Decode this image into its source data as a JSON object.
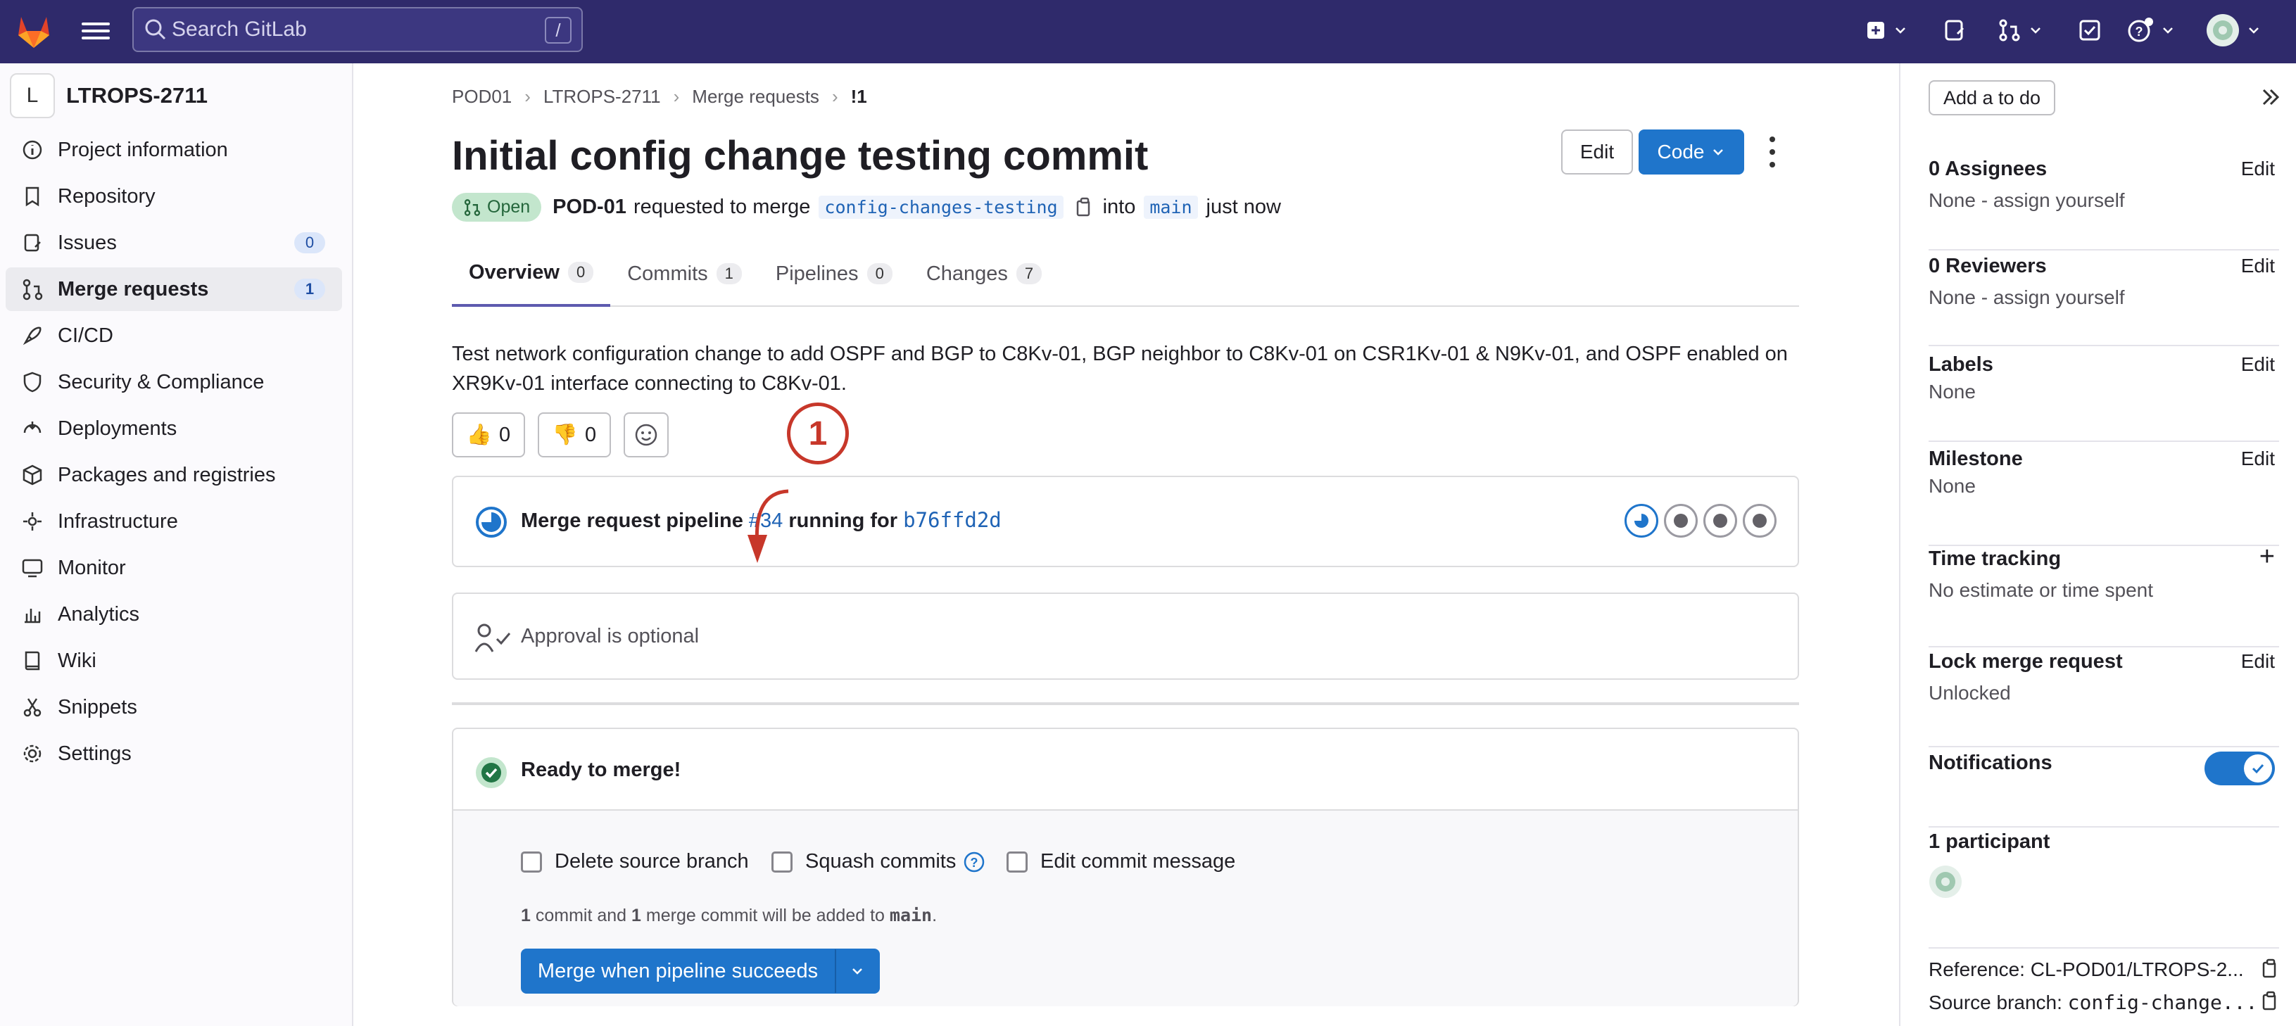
{
  "topbar": {
    "search_placeholder": "Search GitLab",
    "search_shortcut": "/",
    "icons": [
      "gitlab-logo-icon",
      "hamburger-icon",
      "search-icon",
      "new-item-icon",
      "issues-icon",
      "merge-requests-icon",
      "todos-icon",
      "help-icon",
      "avatar-icon"
    ]
  },
  "sidebar": {
    "project_initial": "L",
    "project_name": "LTROPS-2711",
    "items": [
      {
        "label": "Project information",
        "icon": "info-icon"
      },
      {
        "label": "Repository",
        "icon": "repository-icon"
      },
      {
        "label": "Issues",
        "icon": "issues-icon",
        "badge": "0"
      },
      {
        "label": "Merge requests",
        "icon": "merge-request-icon",
        "badge": "1",
        "active": true
      },
      {
        "label": "CI/CD",
        "icon": "rocket-icon"
      },
      {
        "label": "Security & Compliance",
        "icon": "shield-icon"
      },
      {
        "label": "Deployments",
        "icon": "deployments-icon"
      },
      {
        "label": "Packages and registries",
        "icon": "package-icon"
      },
      {
        "label": "Infrastructure",
        "icon": "cloud-icon"
      },
      {
        "label": "Monitor",
        "icon": "monitor-icon"
      },
      {
        "label": "Analytics",
        "icon": "chart-icon"
      },
      {
        "label": "Wiki",
        "icon": "book-icon"
      },
      {
        "label": "Snippets",
        "icon": "scissors-icon"
      },
      {
        "label": "Settings",
        "icon": "gear-icon"
      }
    ]
  },
  "breadcrumbs": [
    "POD01",
    "LTROPS-2711",
    "Merge requests",
    "!1"
  ],
  "mr": {
    "title": "Initial config change testing commit",
    "edit_label": "Edit",
    "code_label": "Code",
    "status": "Open",
    "author": "POD-01",
    "requested_text": "requested to merge",
    "source_branch": "config-changes-testing",
    "into_text": "into",
    "target_branch": "main",
    "time": "just now"
  },
  "tabs": [
    {
      "label": "Overview",
      "count": "0"
    },
    {
      "label": "Commits",
      "count": "1"
    },
    {
      "label": "Pipelines",
      "count": "0"
    },
    {
      "label": "Changes",
      "count": "7"
    }
  ],
  "description": "Test network configuration change to add OSPF and BGP to C8Kv-01, BGP neighbor to C8Kv-01 on CSR1Kv-01 & N9Kv-01, and OSPF enabled on XR9Kv-01 interface connecting to C8Kv-01.",
  "reactions": {
    "thumbs_up": "0",
    "thumbs_down": "0"
  },
  "pipeline": {
    "prefix": "Merge request pipeline",
    "id": "#34",
    "middle": "running for",
    "sha": "b76ffd2d"
  },
  "annotation": "1",
  "approval": "Approval is optional",
  "merge": {
    "ready": "Ready to merge!",
    "delete_branch": "Delete source branch",
    "squash": "Squash commits",
    "edit_message": "Edit commit message",
    "info_n1": "1",
    "info_t1": "commit and",
    "info_n2": "1",
    "info_t2": "merge commit will be added to",
    "info_branch": "main",
    "info_end": ".",
    "button": "Merge when pipeline succeeds"
  },
  "right": {
    "todo": "Add a to do",
    "assignees_h": "0 Assignees",
    "assignees_v": "None - assign yourself",
    "reviewers_h": "0 Reviewers",
    "reviewers_v": "None - assign yourself",
    "labels_h": "Labels",
    "labels_v": "None",
    "milestone_h": "Milestone",
    "milestone_v": "None",
    "time_h": "Time tracking",
    "time_v": "No estimate or time spent",
    "lock_h": "Lock merge request",
    "lock_v": "Unlocked",
    "notif_h": "Notifications",
    "participants_h": "1 participant",
    "edit": "Edit",
    "plus": "+",
    "reference": "Reference: CL-POD01/LTROPS-2...",
    "source_prefix": "Source branch:",
    "source_val": "config-change..."
  },
  "colors": {
    "topbar": "#2f2a6b",
    "primary": "#1f75cb",
    "annotation": "#c7372a",
    "success": "#217645"
  }
}
